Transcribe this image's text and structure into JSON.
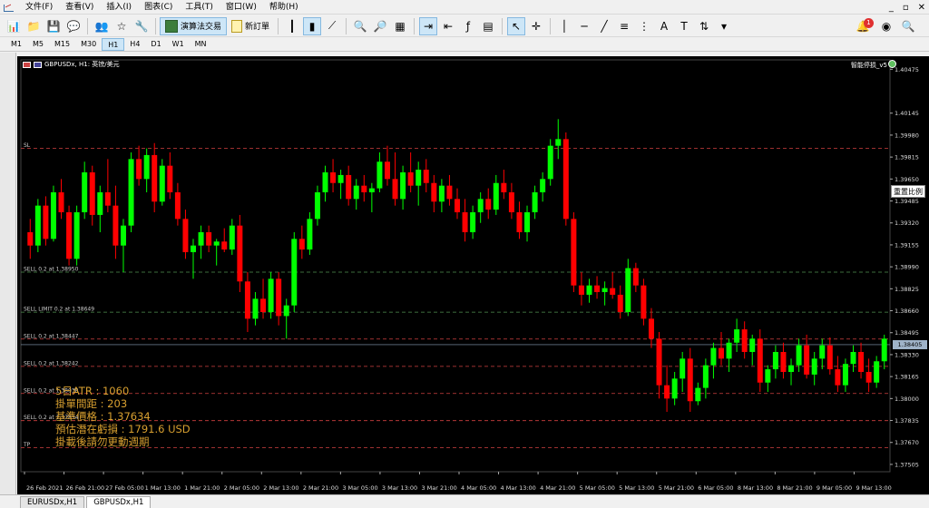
{
  "menu": [
    "文件(F)",
    "查看(V)",
    "插入(I)",
    "图表(C)",
    "工具(T)",
    "窗口(W)",
    "帮助(H)"
  ],
  "window_controls": [
    "_",
    "▫",
    "✕"
  ],
  "toolbar": {
    "algo_trading_label": "演算法交易",
    "new_order_label": "新訂單",
    "notification_count": "1"
  },
  "timeframes": [
    "M1",
    "M5",
    "M15",
    "M30",
    "H1",
    "H4",
    "D1",
    "W1",
    "MN"
  ],
  "active_timeframe": "H1",
  "chart": {
    "title": "GBPUSDx, H1:  英镑/美元",
    "ea_name": "智能停损_v5",
    "reset_zoom_label": "重置比例",
    "current_price": "1.38405",
    "current_price_value": 1.38405,
    "colors": {
      "bull": "#00ff00",
      "bear": "#ff0000",
      "sl": "#d04040",
      "sell": "#509050",
      "grid": "#1a1a1a"
    }
  },
  "tabs": [
    {
      "label": "EURUSDx,H1",
      "active": false
    },
    {
      "label": "GBPUSDx,H1",
      "active": true
    }
  ],
  "stats": [
    "5日ATR : 1060",
    "掛單間距 : 203",
    "基準價格 : 1.37634",
    "預估潛在虧損 : 1791.6 USD",
    "掛載後請勿更動週期"
  ],
  "chart_data": {
    "type": "candlestick",
    "ylim": [
      1.3745,
      1.4045
    ],
    "y_ticks": [
      "1.40475",
      "1.40145",
      "1.39980",
      "1.39815",
      "1.39650",
      "1.39485",
      "1.39320",
      "1.39155",
      "1.38990",
      "1.38825",
      "1.38660",
      "1.38495",
      "1.38330",
      "1.38165",
      "1.38000",
      "1.37835",
      "1.37670",
      "1.37505"
    ],
    "x_ticks": [
      "26 Feb 2021",
      "26 Feb 21:00",
      "27 Feb 05:00",
      "1 Mar 13:00",
      "1 Mar 21:00",
      "2 Mar 05:00",
      "2 Mar 13:00",
      "2 Mar 21:00",
      "3 Mar 05:00",
      "3 Mar 13:00",
      "3 Mar 21:00",
      "4 Mar 05:00",
      "4 Mar 13:00",
      "4 Mar 21:00",
      "5 Mar 05:00",
      "5 Mar 13:00",
      "5 Mar 21:00",
      "6 Mar 05:00",
      "8 Mar 13:00",
      "8 Mar 21:00",
      "9 Mar 05:00",
      "9 Mar 13:00"
    ],
    "levels": [
      {
        "label": "SL",
        "price": 1.3988,
        "color": "#d04040"
      },
      {
        "label": "SELL 0.2 at 1.38950",
        "price": 1.3895,
        "color": "#509050"
      },
      {
        "label": "SELL LIMIT 0.2 at 1.38649",
        "price": 1.38649,
        "color": "#509050"
      },
      {
        "label": "SELL 0.2 at 1.38447",
        "price": 1.38447,
        "color": "#d04040"
      },
      {
        "label": "SELL 0.2 at 1.38242",
        "price": 1.38242,
        "color": "#d04040"
      },
      {
        "label": "SELL 0.2 at 1.38038",
        "price": 1.38038,
        "color": "#d04040"
      },
      {
        "label": "SELL 0.2 at 1.37834",
        "price": 1.37834,
        "color": "#d04040"
      },
      {
        "label": "TP",
        "price": 1.3763,
        "color": "#d04040"
      }
    ],
    "candles": [
      [
        1.3925,
        1.3935,
        1.3905,
        1.3915
      ],
      [
        1.3915,
        1.395,
        1.391,
        1.3945
      ],
      [
        1.3945,
        1.3952,
        1.3915,
        1.392
      ],
      [
        1.392,
        1.396,
        1.3918,
        1.3955
      ],
      [
        1.3955,
        1.3965,
        1.3935,
        1.394
      ],
      [
        1.394,
        1.3945,
        1.39,
        1.3905
      ],
      [
        1.3905,
        1.3945,
        1.39,
        1.394
      ],
      [
        1.394,
        1.3978,
        1.3935,
        1.397
      ],
      [
        1.397,
        1.3975,
        1.393,
        1.3938
      ],
      [
        1.3938,
        1.396,
        1.3925,
        1.3955
      ],
      [
        1.3955,
        1.398,
        1.394,
        1.3945
      ],
      [
        1.3945,
        1.396,
        1.3905,
        1.3915
      ],
      [
        1.3915,
        1.3935,
        1.3895,
        1.393
      ],
      [
        1.393,
        1.3985,
        1.3925,
        1.398
      ],
      [
        1.398,
        1.399,
        1.396,
        1.3965
      ],
      [
        1.3965,
        1.3988,
        1.3955,
        1.3983
      ],
      [
        1.3983,
        1.3992,
        1.394,
        1.3948
      ],
      [
        1.3948,
        1.398,
        1.3945,
        1.3975
      ],
      [
        1.3975,
        1.3985,
        1.395,
        1.3955
      ],
      [
        1.3955,
        1.3962,
        1.393,
        1.3935
      ],
      [
        1.3935,
        1.3942,
        1.3905,
        1.391
      ],
      [
        1.391,
        1.392,
        1.389,
        1.3915
      ],
      [
        1.3915,
        1.393,
        1.3905,
        1.3925
      ],
      [
        1.3925,
        1.393,
        1.391,
        1.3915
      ],
      [
        1.3915,
        1.392,
        1.39,
        1.3918
      ],
      [
        1.3918,
        1.3928,
        1.391,
        1.3912
      ],
      [
        1.3912,
        1.3935,
        1.3908,
        1.393
      ],
      [
        1.393,
        1.3938,
        1.388,
        1.3888
      ],
      [
        1.3888,
        1.3895,
        1.385,
        1.386
      ],
      [
        1.386,
        1.388,
        1.3855,
        1.3875
      ],
      [
        1.3875,
        1.389,
        1.386,
        1.3865
      ],
      [
        1.3865,
        1.3895,
        1.386,
        1.389
      ],
      [
        1.389,
        1.3895,
        1.3855,
        1.3862
      ],
      [
        1.3862,
        1.3875,
        1.3845,
        1.387
      ],
      [
        1.387,
        1.3925,
        1.3865,
        1.392
      ],
      [
        1.392,
        1.393,
        1.3905,
        1.3912
      ],
      [
        1.3912,
        1.394,
        1.3908,
        1.3935
      ],
      [
        1.3935,
        1.396,
        1.393,
        1.3955
      ],
      [
        1.3955,
        1.3975,
        1.3948,
        1.397
      ],
      [
        1.397,
        1.398,
        1.3955,
        1.3962
      ],
      [
        1.3962,
        1.3972,
        1.395,
        1.3968
      ],
      [
        1.3968,
        1.3975,
        1.3945,
        1.395
      ],
      [
        1.395,
        1.3965,
        1.3942,
        1.396
      ],
      [
        1.396,
        1.3968,
        1.3948,
        1.3955
      ],
      [
        1.3955,
        1.3962,
        1.394,
        1.3958
      ],
      [
        1.3958,
        1.3985,
        1.3955,
        1.3978
      ],
      [
        1.3978,
        1.399,
        1.396,
        1.3965
      ],
      [
        1.3965,
        1.3985,
        1.3945,
        1.395
      ],
      [
        1.395,
        1.3975,
        1.3942,
        1.397
      ],
      [
        1.397,
        1.3985,
        1.3955,
        1.396
      ],
      [
        1.396,
        1.3978,
        1.3945,
        1.3972
      ],
      [
        1.3972,
        1.398,
        1.3955,
        1.3962
      ],
      [
        1.3962,
        1.3968,
        1.394,
        1.3948
      ],
      [
        1.3948,
        1.3965,
        1.394,
        1.396
      ],
      [
        1.396,
        1.3968,
        1.3945,
        1.395
      ],
      [
        1.395,
        1.3958,
        1.3935,
        1.394
      ],
      [
        1.394,
        1.395,
        1.3918,
        1.3925
      ],
      [
        1.3925,
        1.3945,
        1.392,
        1.394
      ],
      [
        1.394,
        1.3955,
        1.3932,
        1.395
      ],
      [
        1.395,
        1.3958,
        1.3935,
        1.3942
      ],
      [
        1.3942,
        1.3968,
        1.3938,
        1.3962
      ],
      [
        1.3962,
        1.3972,
        1.395,
        1.3955
      ],
      [
        1.3955,
        1.3962,
        1.3935,
        1.394
      ],
      [
        1.394,
        1.3948,
        1.392,
        1.3925
      ],
      [
        1.3925,
        1.3945,
        1.3918,
        1.394
      ],
      [
        1.394,
        1.396,
        1.3935,
        1.3955
      ],
      [
        1.3955,
        1.397,
        1.3948,
        1.3965
      ],
      [
        1.3965,
        1.3995,
        1.396,
        1.399
      ],
      [
        1.399,
        1.401,
        1.398,
        1.3995
      ],
      [
        1.3995,
        1.4,
        1.393,
        1.3935
      ],
      [
        1.3935,
        1.394,
        1.388,
        1.3885
      ],
      [
        1.3885,
        1.3895,
        1.387,
        1.3878
      ],
      [
        1.3878,
        1.389,
        1.3872,
        1.3885
      ],
      [
        1.3885,
        1.3892,
        1.3875,
        1.388
      ],
      [
        1.388,
        1.3888,
        1.387,
        1.3883
      ],
      [
        1.3883,
        1.3895,
        1.3875,
        1.3878
      ],
      [
        1.3878,
        1.3885,
        1.386,
        1.3865
      ],
      [
        1.3865,
        1.3905,
        1.3862,
        1.3898
      ],
      [
        1.3898,
        1.3902,
        1.388,
        1.3885
      ],
      [
        1.3885,
        1.389,
        1.3855,
        1.386
      ],
      [
        1.386,
        1.3868,
        1.3838,
        1.3845
      ],
      [
        1.3845,
        1.385,
        1.38,
        1.381
      ],
      [
        1.381,
        1.3825,
        1.379,
        1.38
      ],
      [
        1.38,
        1.382,
        1.3795,
        1.3815
      ],
      [
        1.3815,
        1.3835,
        1.3805,
        1.383
      ],
      [
        1.383,
        1.3838,
        1.379,
        1.3798
      ],
      [
        1.3798,
        1.3812,
        1.3795,
        1.3808
      ],
      [
        1.3808,
        1.383,
        1.38,
        1.3825
      ],
      [
        1.3825,
        1.3842,
        1.3815,
        1.3838
      ],
      [
        1.3838,
        1.385,
        1.3825,
        1.383
      ],
      [
        1.383,
        1.3845,
        1.382,
        1.3842
      ],
      [
        1.3842,
        1.386,
        1.3835,
        1.3852
      ],
      [
        1.3852,
        1.3858,
        1.383,
        1.3835
      ],
      [
        1.3835,
        1.3848,
        1.3825,
        1.3845
      ],
      [
        1.3845,
        1.3852,
        1.3805,
        1.3812
      ],
      [
        1.3812,
        1.3825,
        1.3805,
        1.3822
      ],
      [
        1.3822,
        1.384,
        1.3815,
        1.3835
      ],
      [
        1.3835,
        1.3842,
        1.3815,
        1.382
      ],
      [
        1.382,
        1.383,
        1.381,
        1.3825
      ],
      [
        1.3825,
        1.3845,
        1.382,
        1.384
      ],
      [
        1.384,
        1.3848,
        1.3815,
        1.3818
      ],
      [
        1.3818,
        1.3835,
        1.381,
        1.383
      ],
      [
        1.383,
        1.3845,
        1.3822,
        1.384
      ],
      [
        1.384,
        1.3846,
        1.3818,
        1.3822
      ],
      [
        1.3822,
        1.3832,
        1.3805,
        1.381
      ],
      [
        1.381,
        1.383,
        1.3805,
        1.3826
      ],
      [
        1.3826,
        1.384,
        1.382,
        1.3835
      ],
      [
        1.3835,
        1.3842,
        1.3815,
        1.382
      ],
      [
        1.382,
        1.383,
        1.3805,
        1.3812
      ],
      [
        1.3812,
        1.3832,
        1.3808,
        1.3828
      ],
      [
        1.3828,
        1.3848,
        1.3822,
        1.3845
      ]
    ]
  }
}
